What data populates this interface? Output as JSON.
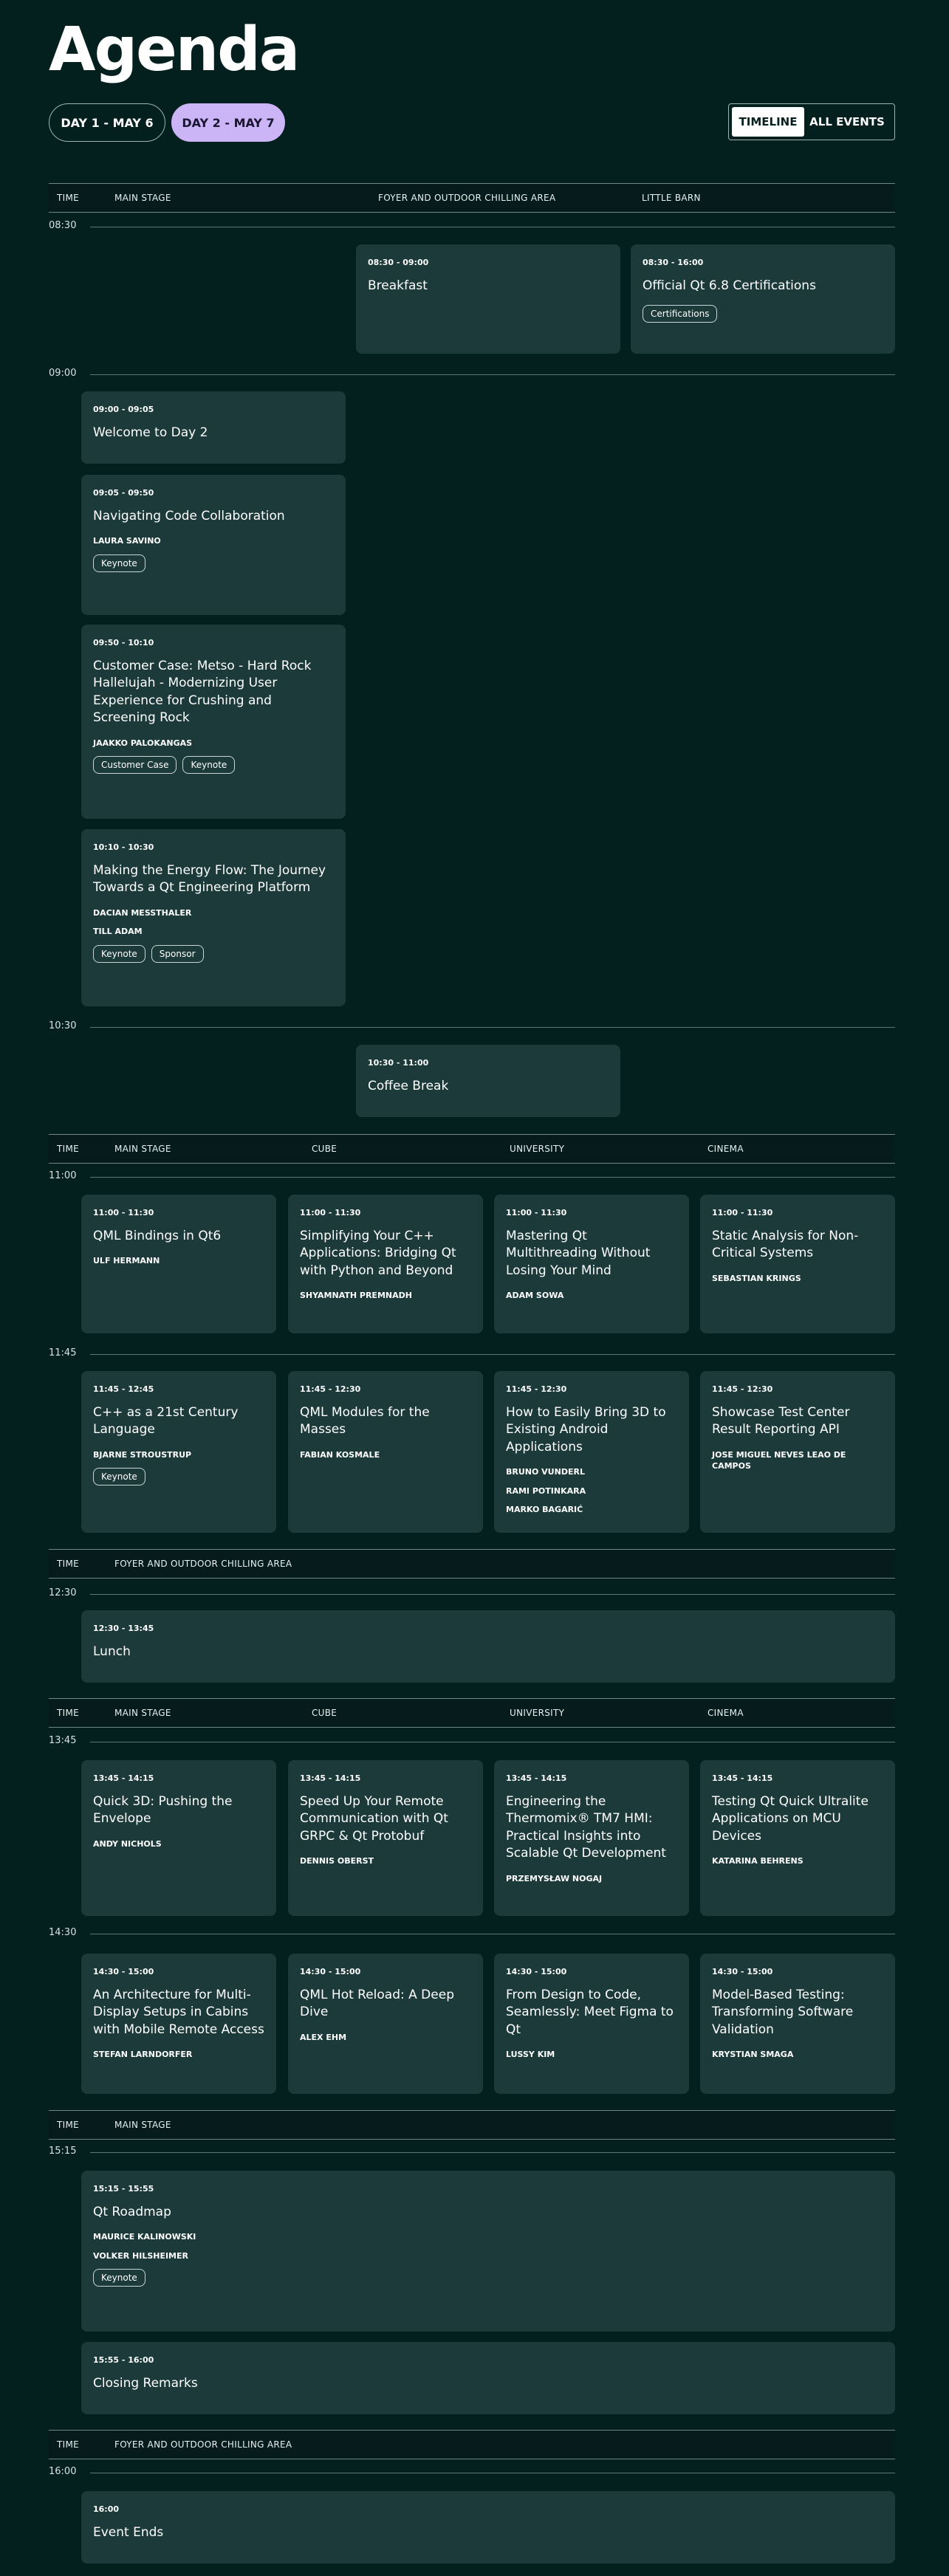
{
  "title": "Agenda",
  "days": [
    "DAY 1 - MAY 6",
    "DAY 2 - MAY 7"
  ],
  "view": [
    "TIMELINE",
    "ALL EVENTS"
  ],
  "headers": [
    [
      "TIME",
      "MAIN STAGE",
      "FOYER AND OUTDOOR CHILLING AREA",
      "LITTLE BARN"
    ],
    [
      "TIME",
      "MAIN STAGE",
      "CUBE",
      "UNIVERSITY",
      "CINEMA"
    ],
    [
      "TIME",
      "FOYER AND OUTDOOR CHILLING AREA"
    ],
    [
      "TIME",
      "MAIN STAGE",
      "CUBE",
      "UNIVERSITY",
      "CINEMA"
    ],
    [
      "TIME",
      "MAIN STAGE"
    ],
    [
      "TIME",
      "FOYER AND OUTDOOR CHILLING AREA"
    ]
  ],
  "times": [
    "08:30",
    "09:00",
    "10:30",
    "11:00",
    "11:45",
    "12:30",
    "13:45",
    "14:30",
    "15:15",
    "16:00"
  ],
  "sessions": [
    {
      "time": "08:30 - 09:00",
      "title": "Breakfast",
      "speakers": [],
      "tags": []
    },
    {
      "time": "08:30 - 16:00",
      "title": "Official Qt 6.8 Certifications",
      "speakers": [],
      "tags": [
        "Certifications"
      ]
    },
    {
      "time": "09:00 - 09:05",
      "title": "Welcome to Day 2",
      "speakers": [],
      "tags": []
    },
    {
      "time": "09:05 - 09:50",
      "title": "Navigating Code Collaboration",
      "speakers": [
        "LAURA SAVINO"
      ],
      "tags": [
        "Keynote"
      ]
    },
    {
      "time": "09:50 - 10:10",
      "title": "Customer Case: Metso - Hard Rock Hallelujah - Modernizing User Experience for Crushing and Screening Rock",
      "speakers": [
        "JAAKKO PALOKANGAS"
      ],
      "tags": [
        "Customer Case",
        "Keynote"
      ]
    },
    {
      "time": "10:10 - 10:30",
      "title": "Making the Energy Flow: The Journey Towards a Qt Engineering Platform",
      "speakers": [
        "DACIAN MESSTHALER",
        "TILL ADAM"
      ],
      "tags": [
        "Keynote",
        "Sponsor"
      ]
    },
    {
      "time": "10:30 - 11:00",
      "title": "Coffee Break",
      "speakers": [],
      "tags": []
    },
    {
      "time": "11:00 - 11:30",
      "title": "QML Bindings in Qt6",
      "speakers": [
        "ULF HERMANN"
      ],
      "tags": []
    },
    {
      "time": "11:00 - 11:30",
      "title": "Simplifying Your C++ Applications: Bridging Qt with Python and Beyond",
      "speakers": [
        "SHYAMNATH PREMNADH"
      ],
      "tags": []
    },
    {
      "time": "11:00 - 11:30",
      "title": "Mastering Qt Multithreading Without Losing Your Mind",
      "speakers": [
        "ADAM SOWA"
      ],
      "tags": []
    },
    {
      "time": "11:00 - 11:30",
      "title": "Static Analysis for Non-Critical Systems",
      "speakers": [
        "SEBASTIAN KRINGS"
      ],
      "tags": []
    },
    {
      "time": "11:45 - 12:45",
      "title": "C++ as a 21st Century Language",
      "speakers": [
        "BJARNE STROUSTRUP"
      ],
      "tags": [
        "Keynote"
      ]
    },
    {
      "time": "11:45 - 12:30",
      "title": "QML Modules for the Masses",
      "speakers": [
        "FABIAN KOSMALE"
      ],
      "tags": []
    },
    {
      "time": "11:45 - 12:30",
      "title": "How to Easily Bring 3D to Existing Android Applications",
      "speakers": [
        "BRUNO VUNDERL",
        "RAMI POTINKARA",
        "MARKO BAGARIĆ"
      ],
      "tags": []
    },
    {
      "time": "11:45 - 12:30",
      "title": "Showcase Test Center Result Reporting API",
      "speakers": [
        "JOSE MIGUEL NEVES LEAO DE CAMPOS"
      ],
      "tags": []
    },
    {
      "time": "12:30 - 13:45",
      "title": "Lunch",
      "speakers": [],
      "tags": []
    },
    {
      "time": "13:45 - 14:15",
      "title": "Quick 3D: Pushing the Envelope",
      "speakers": [
        "ANDY NICHOLS"
      ],
      "tags": []
    },
    {
      "time": "13:45 - 14:15",
      "title": "Speed Up Your Remote Communication with Qt GRPC & Qt Protobuf",
      "speakers": [
        "DENNIS OBERST"
      ],
      "tags": []
    },
    {
      "time": "13:45 - 14:15",
      "title": "Engineering the Thermomix® TM7 HMI: Practical Insights into Scalable Qt Development",
      "speakers": [
        "PRZEMYSŁAW NOGAJ"
      ],
      "tags": []
    },
    {
      "time": "13:45 - 14:15",
      "title": "Testing Qt Quick Ultralite Applications on MCU Devices",
      "speakers": [
        "KATARINA BEHRENS"
      ],
      "tags": []
    },
    {
      "time": "14:30 - 15:00",
      "title": "An Architecture for Multi-Display Setups in Cabins with Mobile Remote Access",
      "speakers": [
        "STEFAN LARNDORFER"
      ],
      "tags": []
    },
    {
      "time": "14:30 - 15:00",
      "title": "QML Hot Reload: A Deep Dive",
      "speakers": [
        "ALEX EHM"
      ],
      "tags": []
    },
    {
      "time": "14:30 - 15:00",
      "title": "From Design to Code, Seamlessly: Meet Figma to Qt",
      "speakers": [
        "LUSSY KIM"
      ],
      "tags": []
    },
    {
      "time": "14:30 - 15:00",
      "title": "Model-Based Testing: Transforming Software Validation",
      "speakers": [
        "KRYSTIAN SMAGA"
      ],
      "tags": []
    },
    {
      "time": "15:15 - 15:55",
      "title": "Qt Roadmap",
      "speakers": [
        "MAURICE KALINOWSKI",
        "VOLKER HILSHEIMER"
      ],
      "tags": [
        "Keynote"
      ]
    },
    {
      "time": "15:55 - 16:00",
      "title": "Closing Remarks",
      "speakers": [],
      "tags": []
    },
    {
      "time": "16:00",
      "title": "Event Ends",
      "speakers": [],
      "tags": []
    }
  ]
}
